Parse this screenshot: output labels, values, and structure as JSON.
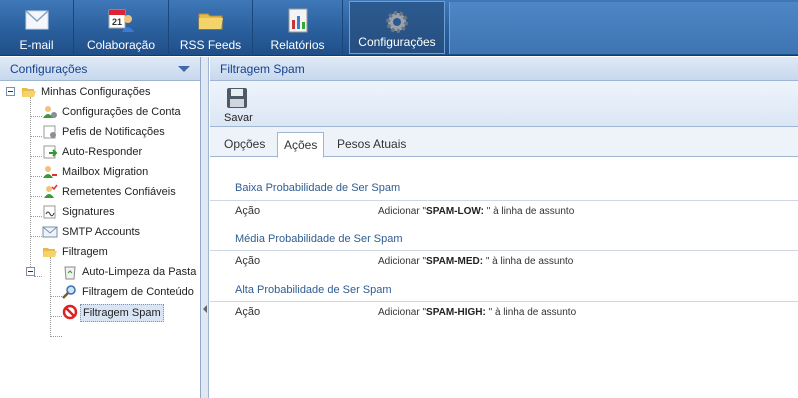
{
  "apps": [
    {
      "label": "E-mail",
      "icon": "email-icon"
    },
    {
      "label": "Colaboração",
      "icon": "calendar-contacts-icon"
    },
    {
      "label": "RSS Feeds",
      "icon": "folder-icon"
    },
    {
      "label": "Relatórios",
      "icon": "report-icon"
    },
    {
      "label": "Configurações",
      "icon": "gear-icon",
      "active": true
    }
  ],
  "left_panel": {
    "title": "Configurações",
    "tree": {
      "root": "Minhas Configurações",
      "items": [
        "Configurações de Conta",
        "Pefis de Notificações",
        "Auto-Responder",
        "Mailbox Migration",
        "Remetentes Confiáveis",
        "Signatures",
        "SMTP Accounts"
      ],
      "filter_folder": "Filtragem",
      "filter_items": [
        "Auto-Limpeza da Pasta",
        "Filtragem de Conteúdo",
        "Filtragem Spam"
      ],
      "selected": "Filtragem Spam"
    }
  },
  "right_panel": {
    "title": "Filtragem Spam",
    "toolbar": {
      "save_label": "Savar"
    },
    "tabs": [
      {
        "label": "Opções"
      },
      {
        "label": "Ações",
        "active": true
      },
      {
        "label": "Pesos Atuais"
      }
    ],
    "sections": [
      {
        "heading": "Baixa Probabilidade de Ser Spam",
        "key": "Ação",
        "prefix": "Adicionar \"",
        "tag": "SPAM-LOW: ",
        "suffix": "\" à linha de assunto"
      },
      {
        "heading": "Média Probabilidade de Ser Spam",
        "key": "Ação",
        "prefix": "Adicionar \"",
        "tag": "SPAM-MED: ",
        "suffix": "\" à linha de assunto"
      },
      {
        "heading": "Alta Probabilidade de Ser Spam",
        "key": "Ação",
        "prefix": "Adicionar \"",
        "tag": "SPAM-HIGH: ",
        "suffix": "\" à linha de assunto"
      }
    ]
  },
  "colors": {
    "header_text": "#15428b",
    "section_heading": "#2f5d92",
    "toolbar_blue": "#2a5f9d"
  }
}
